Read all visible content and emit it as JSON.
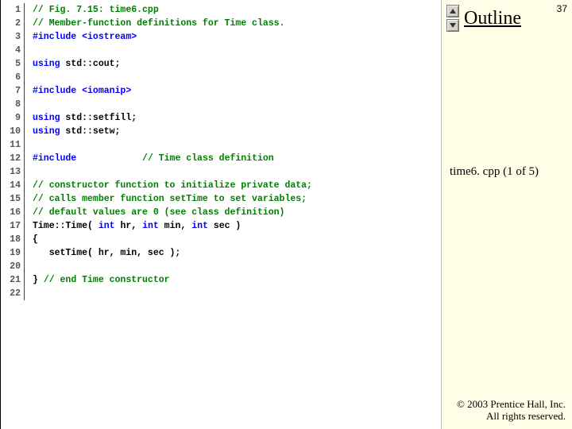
{
  "side": {
    "page_number": "37",
    "outline_label": "Outline",
    "file_caption": "time6. cpp (1 of 5)",
    "copyright_line1": "© 2003 Prentice Hall, Inc.",
    "copyright_line2": "All rights reserved."
  },
  "code": {
    "total_lines": 22,
    "lines": [
      {
        "n": 1,
        "segs": [
          {
            "t": "// Fig. 7.15: time6.cpp",
            "c": "c-comment"
          }
        ]
      },
      {
        "n": 2,
        "segs": [
          {
            "t": "// Member-function definitions for Time class.",
            "c": "c-comment"
          }
        ]
      },
      {
        "n": 3,
        "segs": [
          {
            "t": "#include ",
            "c": "c-pre"
          },
          {
            "t": "<iostream>",
            "c": "c-header"
          }
        ]
      },
      {
        "n": 4,
        "segs": []
      },
      {
        "n": 5,
        "segs": [
          {
            "t": "using ",
            "c": "c-key"
          },
          {
            "t": "std::cout;",
            "c": "c-plain"
          }
        ]
      },
      {
        "n": 6,
        "segs": []
      },
      {
        "n": 7,
        "segs": [
          {
            "t": "#include ",
            "c": "c-pre"
          },
          {
            "t": "<iomanip>",
            "c": "c-header"
          }
        ]
      },
      {
        "n": 8,
        "segs": []
      },
      {
        "n": 9,
        "segs": [
          {
            "t": "using ",
            "c": "c-key"
          },
          {
            "t": "std::setfill;",
            "c": "c-plain"
          }
        ]
      },
      {
        "n": 10,
        "segs": [
          {
            "t": "using ",
            "c": "c-key"
          },
          {
            "t": "std::setw;",
            "c": "c-plain"
          }
        ]
      },
      {
        "n": 11,
        "segs": []
      },
      {
        "n": 12,
        "segs": [
          {
            "t": "#include",
            "c": "c-pre"
          },
          {
            "t": "            ",
            "c": "c-plain"
          },
          {
            "t": "// Time class definition",
            "c": "c-comment"
          }
        ]
      },
      {
        "n": 13,
        "segs": []
      },
      {
        "n": 14,
        "segs": [
          {
            "t": "// constructor function to initialize private data;",
            "c": "c-comment"
          }
        ]
      },
      {
        "n": 15,
        "segs": [
          {
            "t": "// calls member function setTime to set variables;",
            "c": "c-comment"
          }
        ]
      },
      {
        "n": 16,
        "segs": [
          {
            "t": "// default values are 0 (see class definition)",
            "c": "c-comment"
          }
        ]
      },
      {
        "n": 17,
        "segs": [
          {
            "t": "Time::Time( ",
            "c": "c-plain"
          },
          {
            "t": "int",
            "c": "c-key"
          },
          {
            "t": " hr, ",
            "c": "c-plain"
          },
          {
            "t": "int",
            "c": "c-key"
          },
          {
            "t": " min, ",
            "c": "c-plain"
          },
          {
            "t": "int",
            "c": "c-key"
          },
          {
            "t": " sec ) ",
            "c": "c-plain"
          }
        ]
      },
      {
        "n": 18,
        "segs": [
          {
            "t": "{ ",
            "c": "c-plain"
          }
        ]
      },
      {
        "n": 19,
        "segs": [
          {
            "t": "   setTime( hr, min, sec ); ",
            "c": "c-plain"
          }
        ]
      },
      {
        "n": 20,
        "segs": []
      },
      {
        "n": 21,
        "segs": [
          {
            "t": "} ",
            "c": "c-plain"
          },
          {
            "t": "// end Time constructor",
            "c": "c-comment"
          }
        ]
      },
      {
        "n": 22,
        "segs": []
      }
    ]
  }
}
